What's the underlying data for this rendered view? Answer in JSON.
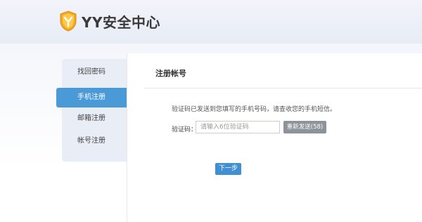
{
  "header": {
    "logo_text": "YY安全中心",
    "logo_icon": "yy-shield-logo-icon",
    "brand_color": "#f5a623"
  },
  "sidebar": {
    "items": [
      {
        "label": "找回密码",
        "active": false
      },
      {
        "label": "手机注册",
        "active": true
      },
      {
        "label": "邮箱注册",
        "active": false
      },
      {
        "label": "帐号注册",
        "active": false
      }
    ],
    "active_color": "#4a9ad8"
  },
  "main": {
    "title": "注册帐号",
    "notice": "验证码已发送到您填写的手机号码，请查收您的手机短信。",
    "code_label": "验证码：",
    "code_placeholder": "请输入6位验证码",
    "code_value": "",
    "resend_label": "重新发送(58)",
    "next_label": "下一步"
  }
}
